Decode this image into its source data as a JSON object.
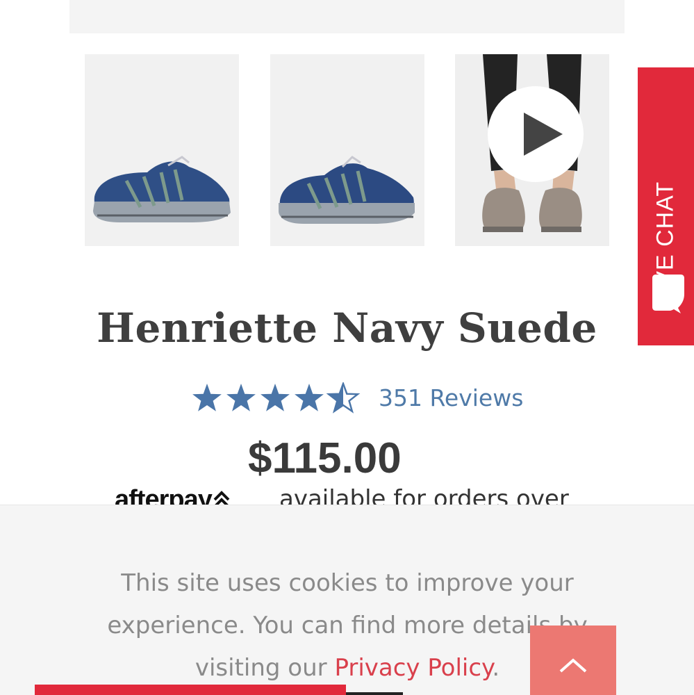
{
  "product": {
    "title": "Henriette Navy Suede",
    "rating": 4.5,
    "rating_max": 5,
    "reviews_label": "351 Reviews",
    "price": "$115.00"
  },
  "afterpay": {
    "logo_text": "afterpay",
    "text": "available for orders over"
  },
  "live_chat": {
    "label": "LIVE CHAT"
  },
  "cookie_banner": {
    "text_before": "This site uses cookies to improve your experience. You can find more details by visiting our ",
    "link_label": "Privacy Policy",
    "text_after": "."
  },
  "colors": {
    "accent_red": "#e1293b",
    "star_blue": "#4a75a8",
    "link_blue": "#4f7aa8",
    "privacy_link": "#d9404c",
    "scroll_top_bg": "#ec7872"
  },
  "icons": {
    "play": "play-icon",
    "chat": "chat-bubble-icon",
    "scroll_top": "chevron-up-icon",
    "afterpay": "afterpay-arrows-icon"
  }
}
